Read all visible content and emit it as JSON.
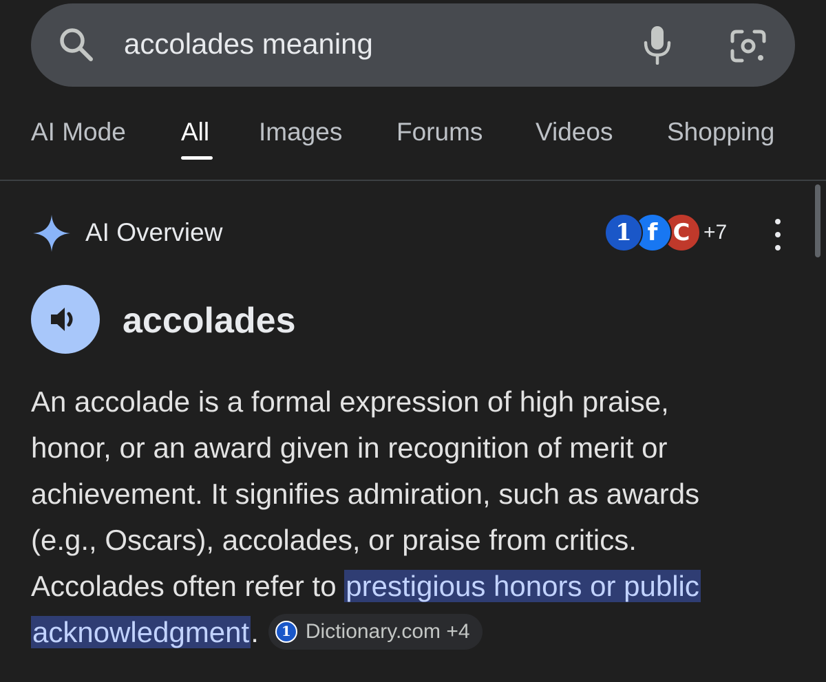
{
  "search": {
    "query": "accolades meaning"
  },
  "tabs": [
    {
      "label": "AI Mode"
    },
    {
      "label": "All"
    },
    {
      "label": "Images"
    },
    {
      "label": "Forums"
    },
    {
      "label": "Videos"
    },
    {
      "label": "Shopping"
    }
  ],
  "active_tab": "All",
  "ai_overview": {
    "title": "AI Overview",
    "source_more": "+7",
    "source_logos": [
      "Dictionary.com",
      "Facebook",
      "C"
    ],
    "source_letters": [
      "1",
      "f",
      "C"
    ]
  },
  "term": {
    "word": "accolades"
  },
  "definition": {
    "line1": "An accolade is a formal expression of high praise,",
    "line2": "honor, or an award given in recognition of merit or",
    "line3": "achievement. It signifies admiration, such as awards",
    "line4": "(e.g., Oscars), accolades, or praise from critics.",
    "line5_pre": "Accolades often refer to ",
    "line5_highlight": "prestigious honors or public",
    "line6_highlight": "acknowledgment",
    "line6_post": "."
  },
  "citation": {
    "label": "Dictionary.com +4",
    "icon_letter": "1"
  },
  "colors": {
    "background": "#1f1f1f",
    "search_bar": "#474a4f",
    "highlight_bg": "#2f3d73",
    "highlight_text": "#c2d3ff",
    "speaker_bg": "#a8c7fa",
    "sparkle": "#8ab4f8"
  }
}
